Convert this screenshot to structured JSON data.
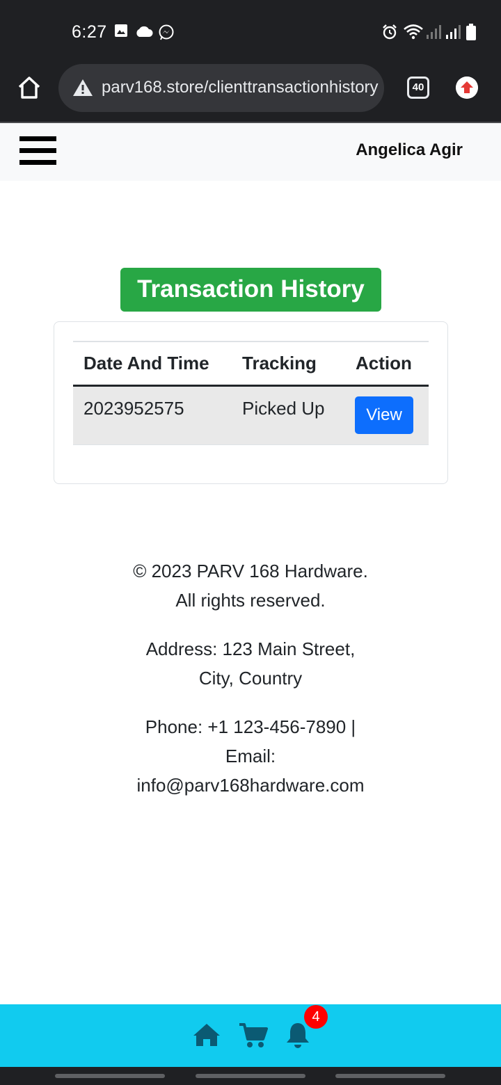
{
  "status_bar": {
    "time": "6:27",
    "left_icons": [
      "gallery-icon",
      "cloud-icon",
      "messenger-icon"
    ],
    "right_icons": [
      "alarm-icon",
      "wifi-icon",
      "signal-icon",
      "signal-icon",
      "battery-icon"
    ]
  },
  "browser": {
    "url": "parv168.store/clienttransactionhistory",
    "tab_count": "40"
  },
  "navbar": {
    "user_name": "Angelica Agir"
  },
  "page": {
    "title": "Transaction History"
  },
  "table": {
    "headers": [
      "Date And Time",
      "Tracking",
      "Action"
    ],
    "rows": [
      {
        "date": "2023952575",
        "tracking": "Picked Up",
        "action": "View"
      }
    ]
  },
  "footer": {
    "copyright_1": "© 2023 PARV 168 Hardware.",
    "copyright_2": "All rights reserved.",
    "address_1": "Address: 123 Main Street,",
    "address_2": "City, Country",
    "phone": "Phone: +1 123-456-7890 |",
    "email_label": "Email:",
    "email": "info@parv168hardware.com"
  },
  "bottom_nav": {
    "notification_count": "4",
    "accent_color": "#11cbef",
    "icon_color": "#0b5a73"
  }
}
